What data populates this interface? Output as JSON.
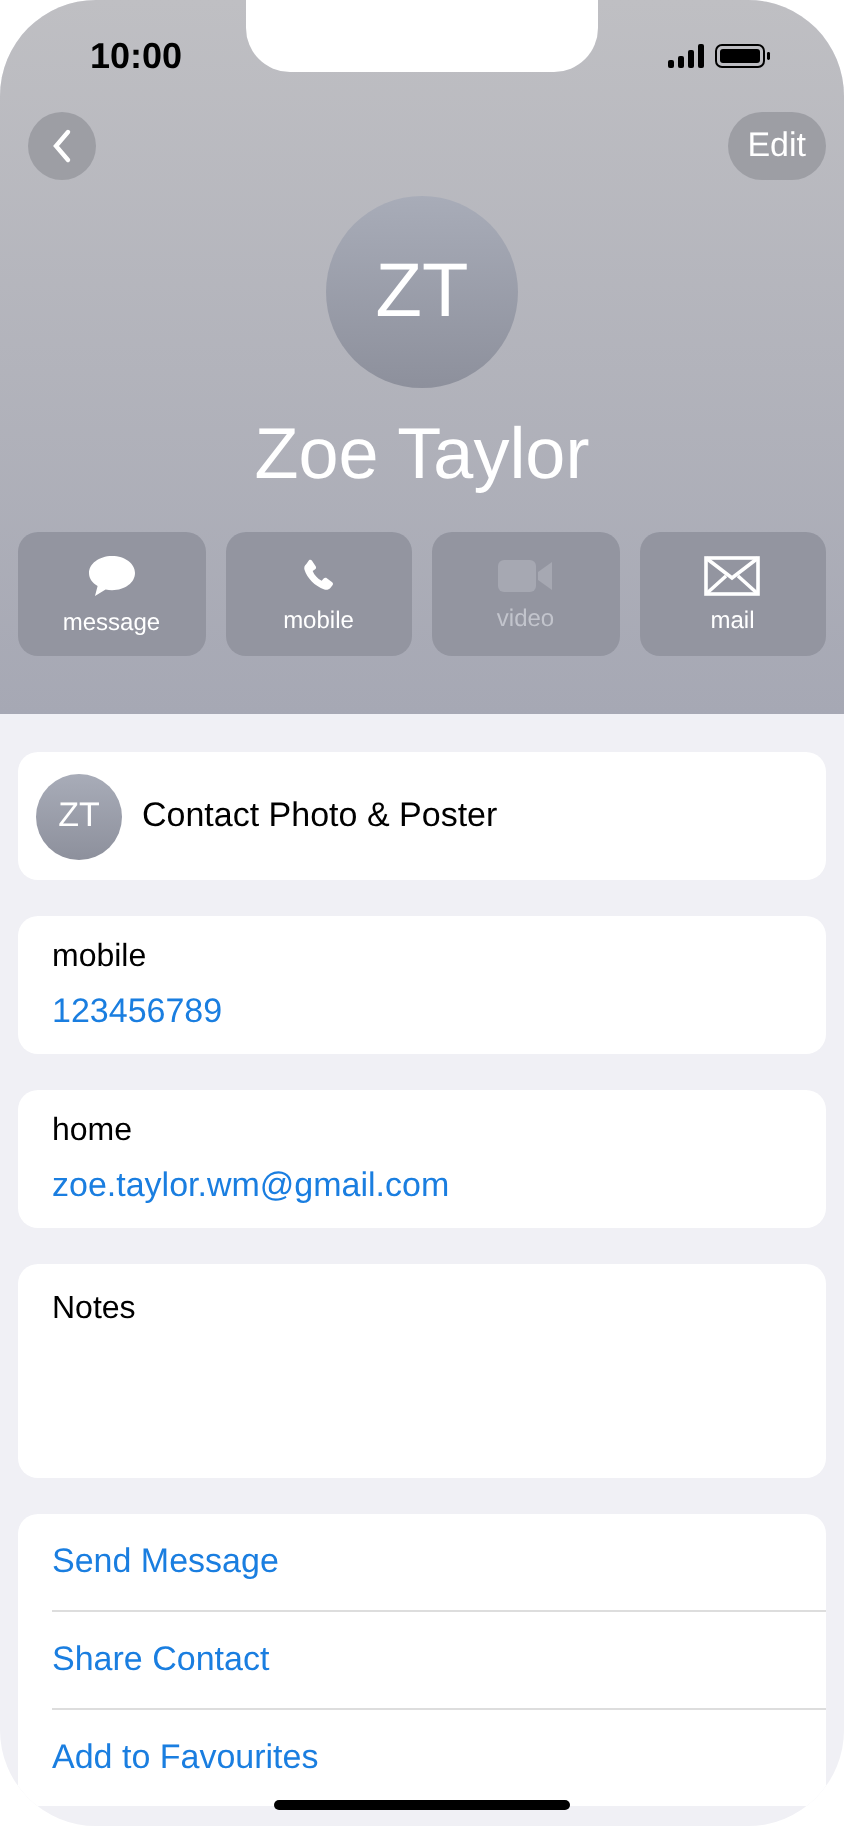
{
  "status_bar": {
    "time": "10:00"
  },
  "nav": {
    "edit": "Edit"
  },
  "contact": {
    "initials": "ZT",
    "name": "Zoe Taylor"
  },
  "actions": [
    {
      "kind": "message",
      "label": "message",
      "disabled": false
    },
    {
      "kind": "phone",
      "label": "mobile",
      "disabled": false
    },
    {
      "kind": "video",
      "label": "video",
      "disabled": true
    },
    {
      "kind": "mail",
      "label": "mail",
      "disabled": false
    }
  ],
  "poster_row": {
    "initials": "ZT",
    "label": "Contact Photo & Poster"
  },
  "fields": [
    {
      "label": "mobile",
      "value": "123456789"
    },
    {
      "label": "home",
      "value": "zoe.taylor.wm@gmail.com"
    }
  ],
  "notes": {
    "label": "Notes"
  },
  "links": [
    "Send Message",
    "Share Contact",
    "Add to Favourites"
  ]
}
